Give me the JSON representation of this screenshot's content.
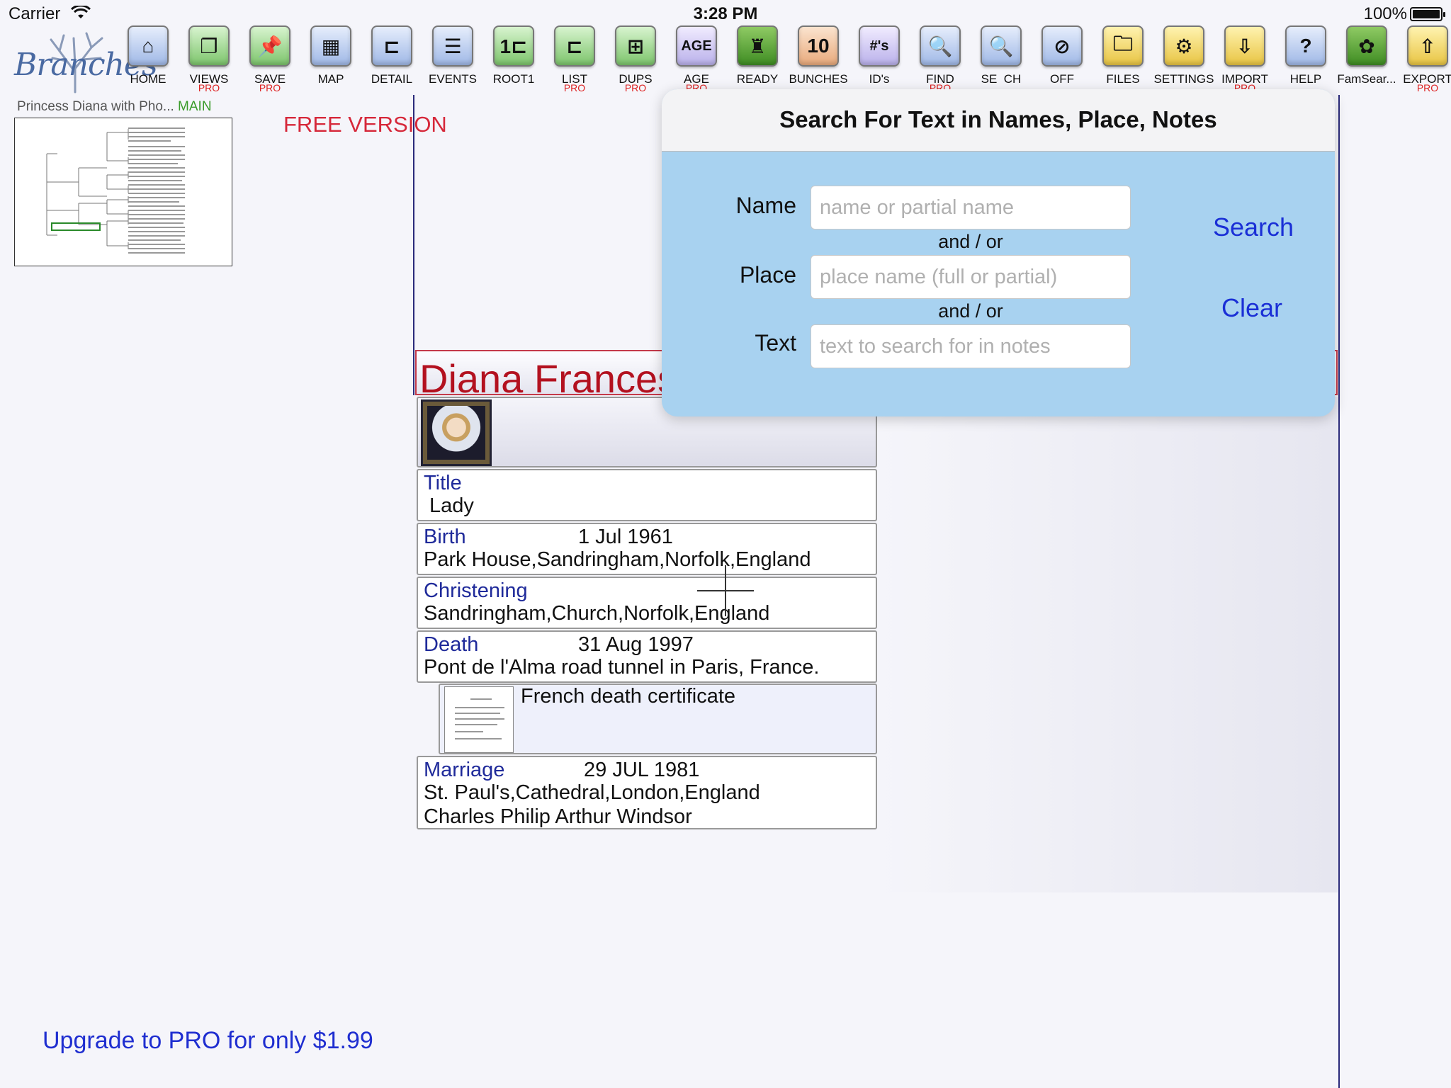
{
  "status": {
    "carrier": "Carrier",
    "time": "3:28 PM",
    "battery": "100%"
  },
  "app": {
    "logo": "Branches"
  },
  "toolbar": [
    {
      "id": "home",
      "label": "HOME",
      "icon": "house-icon",
      "glyph": "⌂",
      "cls": "ic-blue",
      "pro": ""
    },
    {
      "id": "views",
      "label": "VIEWS",
      "icon": "views-icon",
      "glyph": "❐",
      "cls": "ic-green",
      "pro": "PRO"
    },
    {
      "id": "save",
      "label": "SAVE",
      "icon": "pushpin-icon",
      "glyph": "📌",
      "cls": "ic-green",
      "pro": "PRO"
    },
    {
      "id": "map",
      "label": "MAP",
      "icon": "map-icon",
      "glyph": "▦",
      "cls": "ic-blue",
      "pro": ""
    },
    {
      "id": "detail",
      "label": "DETAIL",
      "icon": "detail-icon",
      "glyph": "⊏",
      "cls": "ic-blue",
      "pro": ""
    },
    {
      "id": "events",
      "label": "EVENTS",
      "icon": "list-icon",
      "glyph": "☰",
      "cls": "ic-blue",
      "pro": ""
    },
    {
      "id": "root1",
      "label": "ROOT1",
      "icon": "root-tree-icon",
      "glyph": "1⊏",
      "cls": "ic-green",
      "pro": ""
    },
    {
      "id": "list",
      "label": "LIST",
      "icon": "tree-list-icon",
      "glyph": "⊏",
      "cls": "ic-green",
      "pro": "PRO"
    },
    {
      "id": "dups",
      "label": "DUPS",
      "icon": "duplicates-icon",
      "glyph": "⊞",
      "cls": "ic-green",
      "pro": "PRO"
    },
    {
      "id": "age",
      "label": "AGE",
      "icon": "age-icon",
      "glyph": "AGE",
      "cls": "ic-lav",
      "pro": "PRO"
    },
    {
      "id": "ready",
      "label": "READY",
      "icon": "ready-icon",
      "glyph": "♜",
      "cls": "ic-darkgreen",
      "pro": ""
    },
    {
      "id": "bunches",
      "label": "BUNCHES",
      "icon": "bunches-icon",
      "glyph": "10",
      "cls": "ic-peach",
      "pro": ""
    },
    {
      "id": "ids",
      "label": "ID's",
      "icon": "hash-icon",
      "glyph": "#'s",
      "cls": "ic-lav",
      "pro": ""
    },
    {
      "id": "find",
      "label": "FIND",
      "icon": "find-magnifier-icon",
      "glyph": "🔍",
      "cls": "ic-blue",
      "pro": "PRO"
    },
    {
      "id": "search",
      "label": "SE  CH",
      "icon": "search-magnifier-icon",
      "glyph": "🔍",
      "cls": "ic-blue",
      "pro": ""
    },
    {
      "id": "off",
      "label": "OFF",
      "icon": "search-off-icon",
      "glyph": "⊘",
      "cls": "ic-blue",
      "pro": ""
    },
    {
      "id": "files",
      "label": "FILES",
      "icon": "folder-icon",
      "glyph": "🗀",
      "cls": "ic-yellow",
      "pro": ""
    },
    {
      "id": "settings",
      "label": "SETTINGS",
      "icon": "gear-icon",
      "glyph": "⚙",
      "cls": "ic-yellow",
      "pro": ""
    },
    {
      "id": "import",
      "label": "IMPORT",
      "icon": "import-icon",
      "glyph": "⇩",
      "cls": "ic-yellow",
      "pro": "PRO"
    },
    {
      "id": "help",
      "label": "HELP",
      "icon": "help-icon",
      "glyph": "?",
      "cls": "ic-blue",
      "pro": ""
    },
    {
      "id": "famsearch",
      "label": "FamSear...",
      "icon": "familysearch-tree-icon",
      "glyph": "✿",
      "cls": "ic-darkgreen",
      "pro": ""
    },
    {
      "id": "export",
      "label": "EXPORT",
      "icon": "export-icon",
      "glyph": "⇧",
      "cls": "ic-yellow",
      "pro": "PRO"
    }
  ],
  "left": {
    "file_title": "Princess Diana with Pho...",
    "file_tag": "MAIN",
    "free_version": "FREE VERSION",
    "upgrade": "Upgrade to PRO for only $1.99"
  },
  "person": {
    "name": "Diana Frances",
    "title_label": "Title",
    "title_value": "Lady",
    "birth_label": "Birth",
    "birth_date": "1 Jul 1961",
    "birth_place": "Park House,Sandringham,Norfolk,England",
    "christening_label": "Christening",
    "christening_place": "Sandringham,Church,Norfolk,England",
    "death_label": "Death",
    "death_date": "31 Aug 1997",
    "death_place": "Pont de l'Alma road tunnel in Paris, France.",
    "death_media": "French death certificate",
    "marriage_label": "Marriage",
    "marriage_date": "29 JUL 1981",
    "marriage_place": "St. Paul's,Cathedral,London,England",
    "spouse": "Charles Philip Arthur Windsor"
  },
  "search_popover": {
    "title": "Search For Text in Names, Place, Notes",
    "name_label": "Name",
    "name_placeholder": "name or partial name",
    "name_value": "",
    "andor1": "and / or",
    "place_label": "Place",
    "place_placeholder": "place name (full or partial)",
    "place_value": "",
    "andor2": "and / or",
    "text_label": "Text",
    "text_placeholder": "text to search for in notes",
    "text_value": "",
    "search_btn": "Search",
    "clear_btn": "Clear"
  },
  "colors": {
    "accent": "#1a2fd6",
    "name": "#b3111f",
    "free": "#d6283a",
    "popover_bg": "#a8d2f0"
  }
}
